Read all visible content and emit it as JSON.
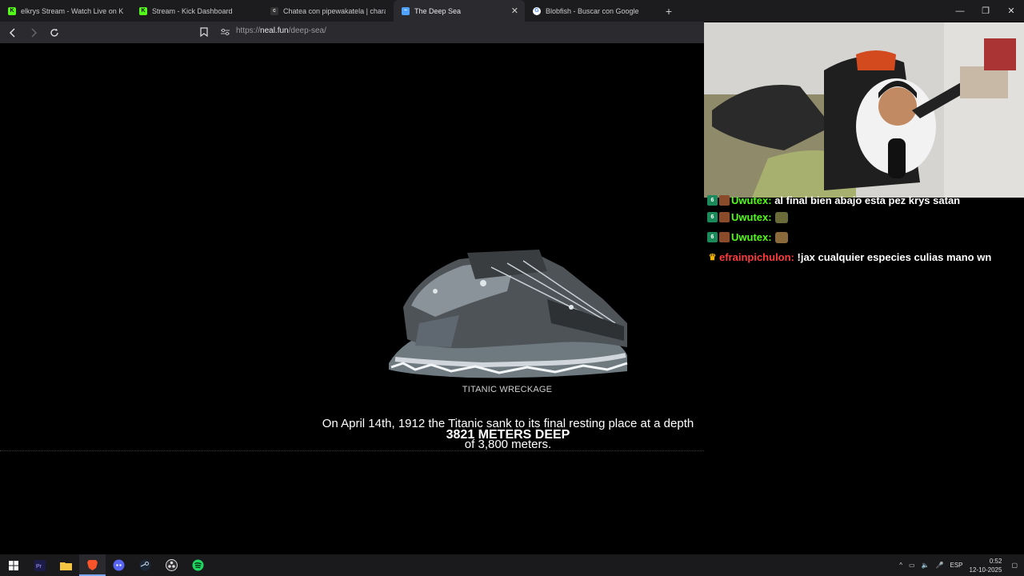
{
  "browser": {
    "tabs": [
      {
        "title": "elkrys Stream - Watch Live on Kick",
        "icon": "kick-icon",
        "color": "#53fc18"
      },
      {
        "title": "Stream - Kick Dashboard",
        "icon": "kick-icon",
        "color": "#53fc18"
      },
      {
        "title": "Chatea con pipewakatela | character",
        "icon": "character-ai-icon",
        "color": "#333333"
      },
      {
        "title": "The Deep Sea",
        "icon": "wave-icon",
        "color": "#4fa3ff",
        "active": true
      },
      {
        "title": "Blobfish - Buscar con Google",
        "icon": "google-icon",
        "color": "#ffffff"
      }
    ],
    "new_tab": "+",
    "window_controls": {
      "minimize": "—",
      "restore": "❐",
      "close": "✕"
    },
    "url_prefix": "https://",
    "url_domain": "neal.fun",
    "url_path": "/deep-sea/"
  },
  "page": {
    "image_caption": "TITANIC WRECKAGE",
    "fact_text": "On April 14th, 1912 the Titanic sank to its final resting place at a depth of 3,800 meters.",
    "depth_readout": "3821 METERS DEEP"
  },
  "chat": [
    {
      "badges": [
        "sub",
        "avatar"
      ],
      "user": "Uwutex:",
      "user_color": "green",
      "text": "al final bien abajo esta pez krys satan",
      "emote": false
    },
    {
      "badges": [
        "sub",
        "avatar"
      ],
      "user": "Uwutex:",
      "user_color": "green",
      "text": "",
      "emote": true,
      "emote_color": "#6b6b3a"
    },
    {
      "badges": [
        "sub",
        "avatar"
      ],
      "user": "Uwutex:",
      "user_color": "green",
      "text": "",
      "emote": true,
      "emote_color": "#8a6a3a"
    },
    {
      "badges": [
        "crown"
      ],
      "user": "efrainpichulon:",
      "user_color": "red",
      "text": "!jax cualquier especies culias mano wn",
      "emote": false
    }
  ],
  "taskbar": {
    "apps": [
      "windows-start-icon",
      "premiere-icon",
      "file-explorer-icon",
      "brave-icon",
      "discord-icon",
      "steam-icon",
      "obs-icon",
      "spotify-icon"
    ],
    "language": "ESP",
    "time": "0:52",
    "date": "12-10-2025"
  }
}
